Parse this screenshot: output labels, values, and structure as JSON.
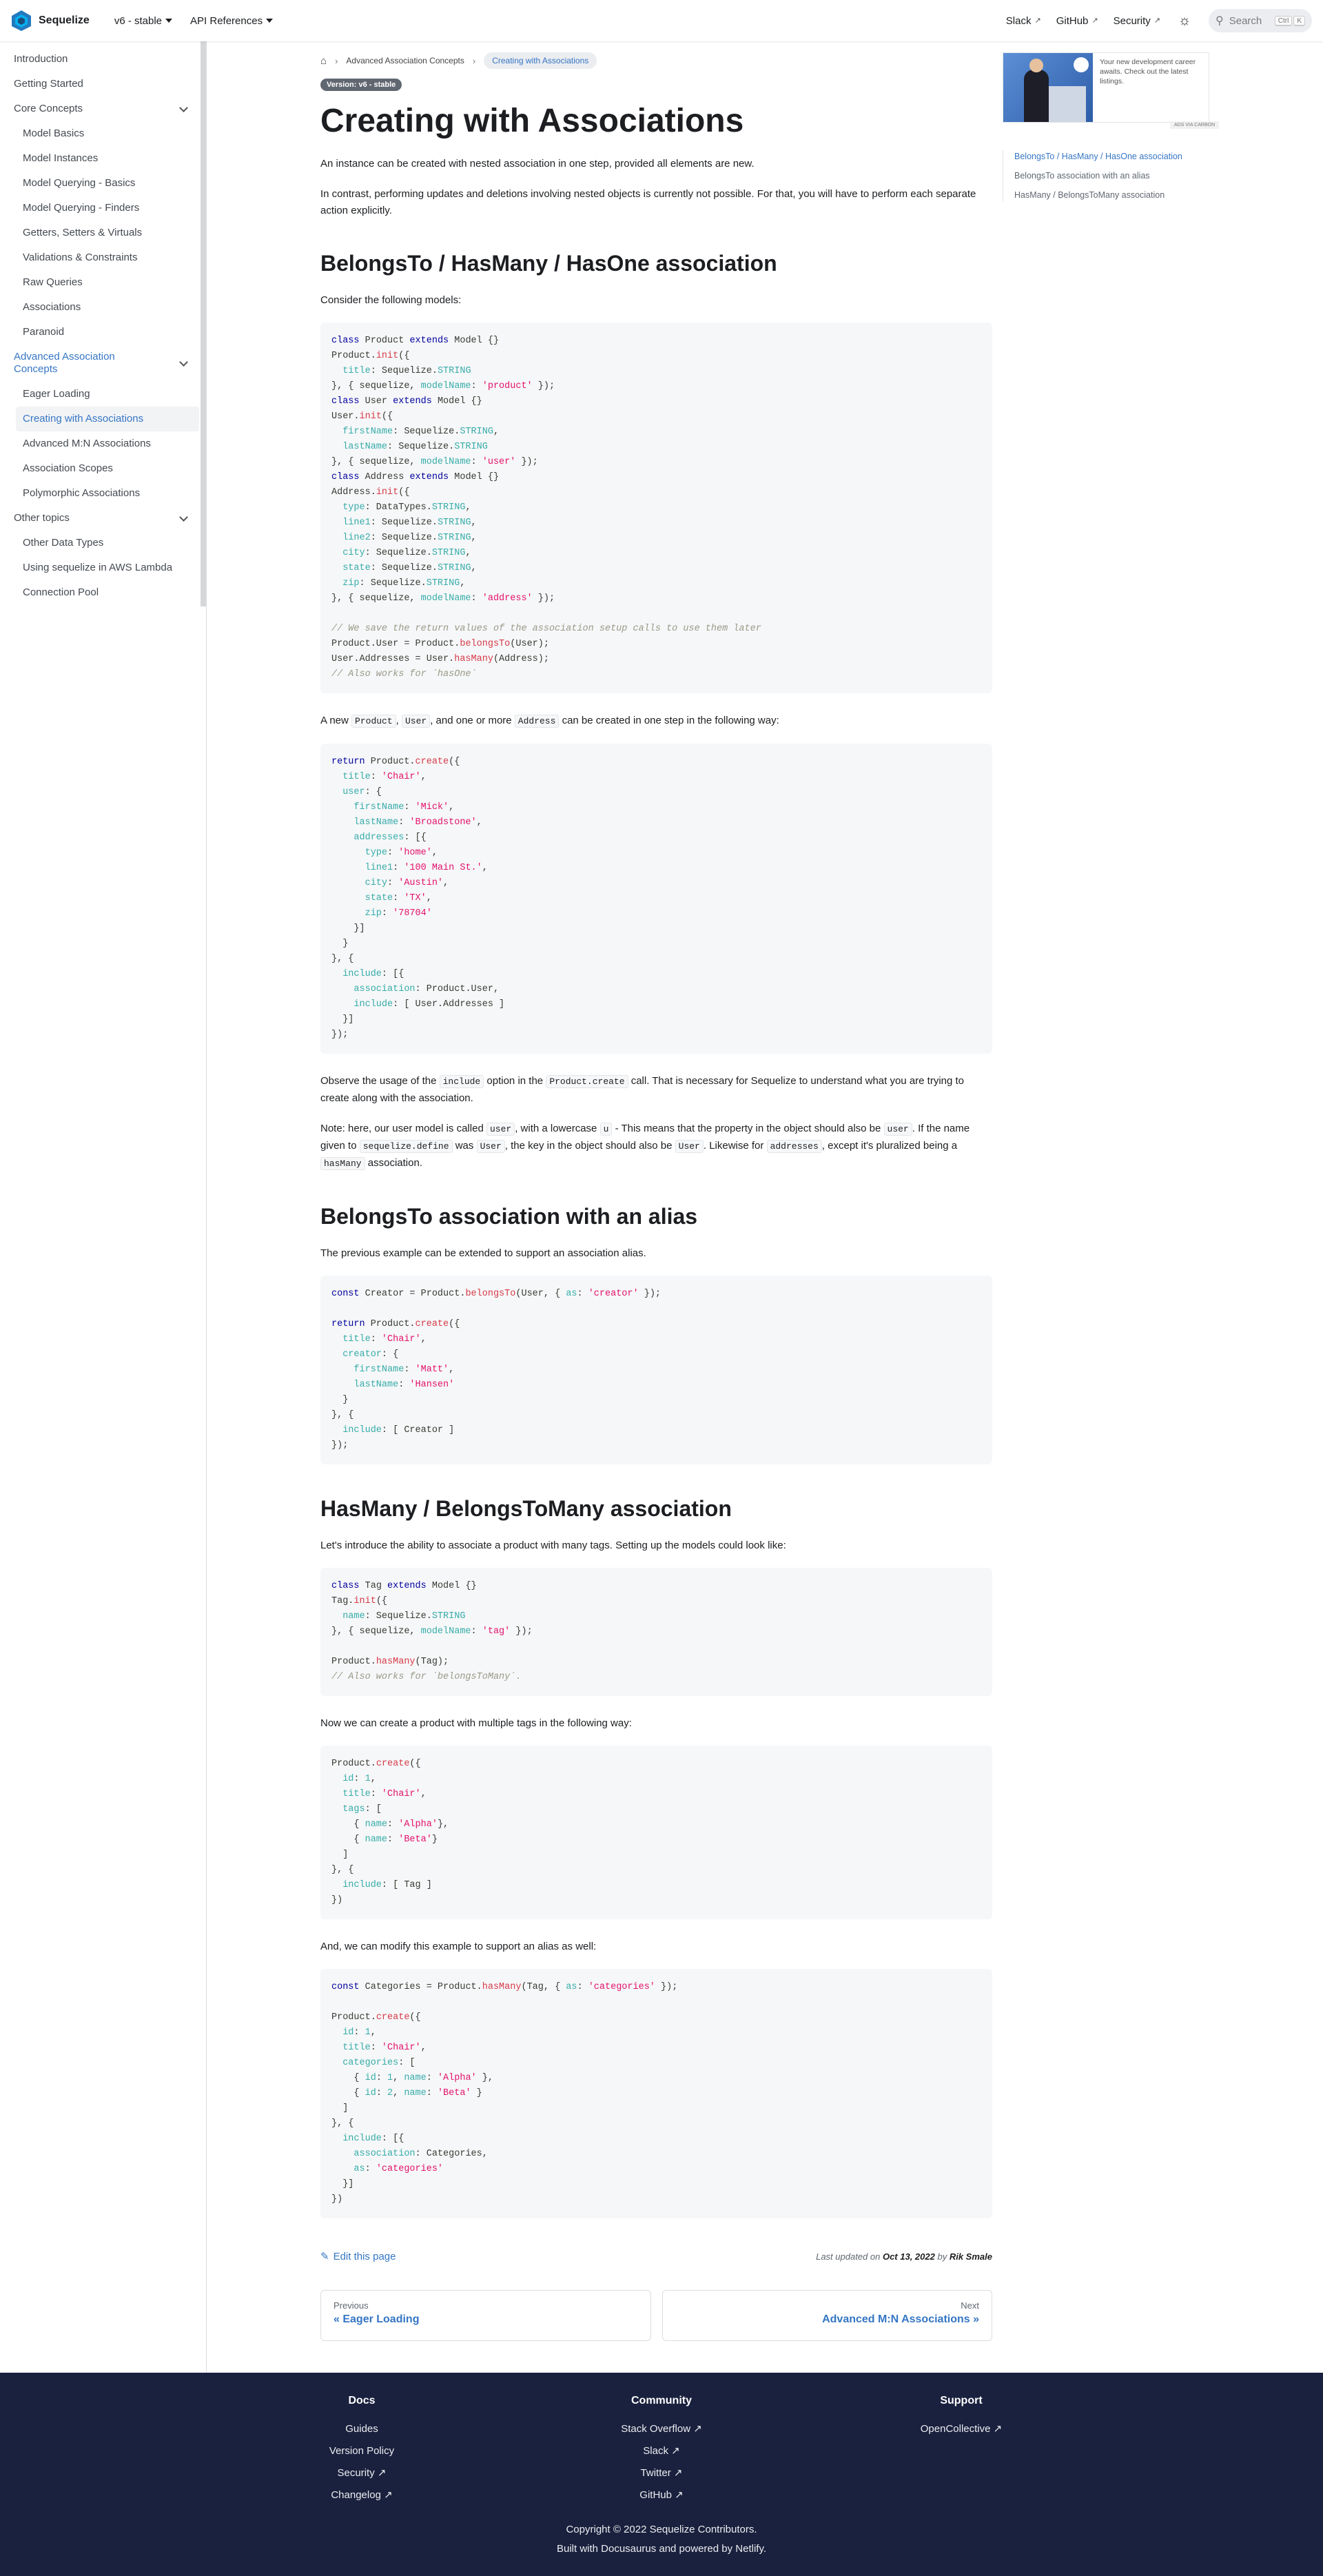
{
  "navbar": {
    "brand": "Sequelize",
    "version_dropdown": "v6 - stable",
    "api_dropdown": "API References",
    "links": [
      "Slack",
      "GitHub",
      "Security"
    ],
    "search_placeholder": "Search",
    "kbd": [
      "Ctrl",
      "K"
    ]
  },
  "sidebar": {
    "top_items": [
      "Introduction",
      "Getting Started"
    ],
    "core_concepts": {
      "label": "Core Concepts",
      "items": [
        "Model Basics",
        "Model Instances",
        "Model Querying - Basics",
        "Model Querying - Finders",
        "Getters, Setters & Virtuals",
        "Validations & Constraints",
        "Raw Queries",
        "Associations",
        "Paranoid"
      ]
    },
    "advanced": {
      "label": "Advanced Association Concepts",
      "items": [
        "Eager Loading",
        "Creating with Associations",
        "Advanced M:N Associations",
        "Association Scopes",
        "Polymorphic Associations"
      ]
    },
    "other": {
      "label": "Other topics",
      "items": [
        "Other Data Types",
        "Using sequelize in AWS Lambda",
        "Connection Pool"
      ]
    }
  },
  "breadcrumbs": {
    "parent": "Advanced Association Concepts",
    "current": "Creating with Associations"
  },
  "badge": "Version: v6 - stable",
  "title": "Creating with Associations",
  "intro": [
    "An instance can be created with nested association in one step, provided all elements are new.",
    "In contrast, performing updates and deletions involving nested objects is currently not possible. For that, you will have to perform each separate action explicitly."
  ],
  "sections": {
    "s1": {
      "heading": "BelongsTo / HasMany / HasOne association",
      "p1": "Consider the following models:",
      "p2a": "A new",
      "c1": "Product",
      "p2b": ",",
      "c2": "User",
      "p2c": ", and one or more",
      "c3": "Address",
      "p2d": "can be created in one step in the following way:",
      "p3a": "Observe the usage of the",
      "c4": "include",
      "p3b": "option in the",
      "c5": "Product.create",
      "p3c": "call. That is necessary for Sequelize to understand what you are trying to create along with the association.",
      "p4a": "Note: here, our user model is called",
      "c6": "user",
      "p4b": ", with a lowercase",
      "c7": "u",
      "p4c": "- This means that the property in the object should also be",
      "c8": "user",
      "p4d": ". If the name given to",
      "c9": "sequelize.define",
      "p4e": "was",
      "c10": "User",
      "p4f": ", the key in the object should also be",
      "c11": "User",
      "p4g": ". Likewise for",
      "c12": "addresses",
      "p4h": ", except it's pluralized being a",
      "c13": "hasMany",
      "p4i": "association."
    },
    "s2": {
      "heading": "BelongsTo association with an alias",
      "p1": "The previous example can be extended to support an association alias."
    },
    "s3": {
      "heading": "HasMany / BelongsToMany association",
      "p1": "Let's introduce the ability to associate a product with many tags. Setting up the models could look like:",
      "p2": "Now we can create a product with multiple tags in the following way:",
      "p3": "And, we can modify this example to support an alias as well:"
    }
  },
  "toc": {
    "ad_text": "Your new development career awaits. Check out the latest listings.",
    "ad_carbon": "ADS VIA CARBON",
    "items": [
      "BelongsTo / HasMany / HasOne association",
      "BelongsTo association with an alias",
      "HasMany / BelongsToMany association"
    ]
  },
  "page_footer": {
    "edit": "Edit this page",
    "last_updated_prefix": "Last updated on",
    "date": "Oct 13, 2022",
    "by": "by",
    "author": "Rik Smale",
    "prev_sub": "Previous",
    "prev_label": "« Eager Loading",
    "next_sub": "Next",
    "next_label": "Advanced M:N Associations »"
  },
  "footer": {
    "docs": {
      "title": "Docs",
      "links": [
        "Guides",
        "Version Policy",
        "Security",
        "Changelog"
      ]
    },
    "community": {
      "title": "Community",
      "links": [
        "Stack Overflow",
        "Slack",
        "Twitter",
        "GitHub"
      ]
    },
    "support": {
      "title": "Support",
      "links": [
        "OpenCollective"
      ]
    },
    "copyright": "Copyright © 2022 Sequelize Contributors.",
    "built": "Built with Docusaurus and powered by Netlify."
  },
  "colors": {
    "accent": "#3576c4",
    "footer_bg": "#1a213e"
  }
}
